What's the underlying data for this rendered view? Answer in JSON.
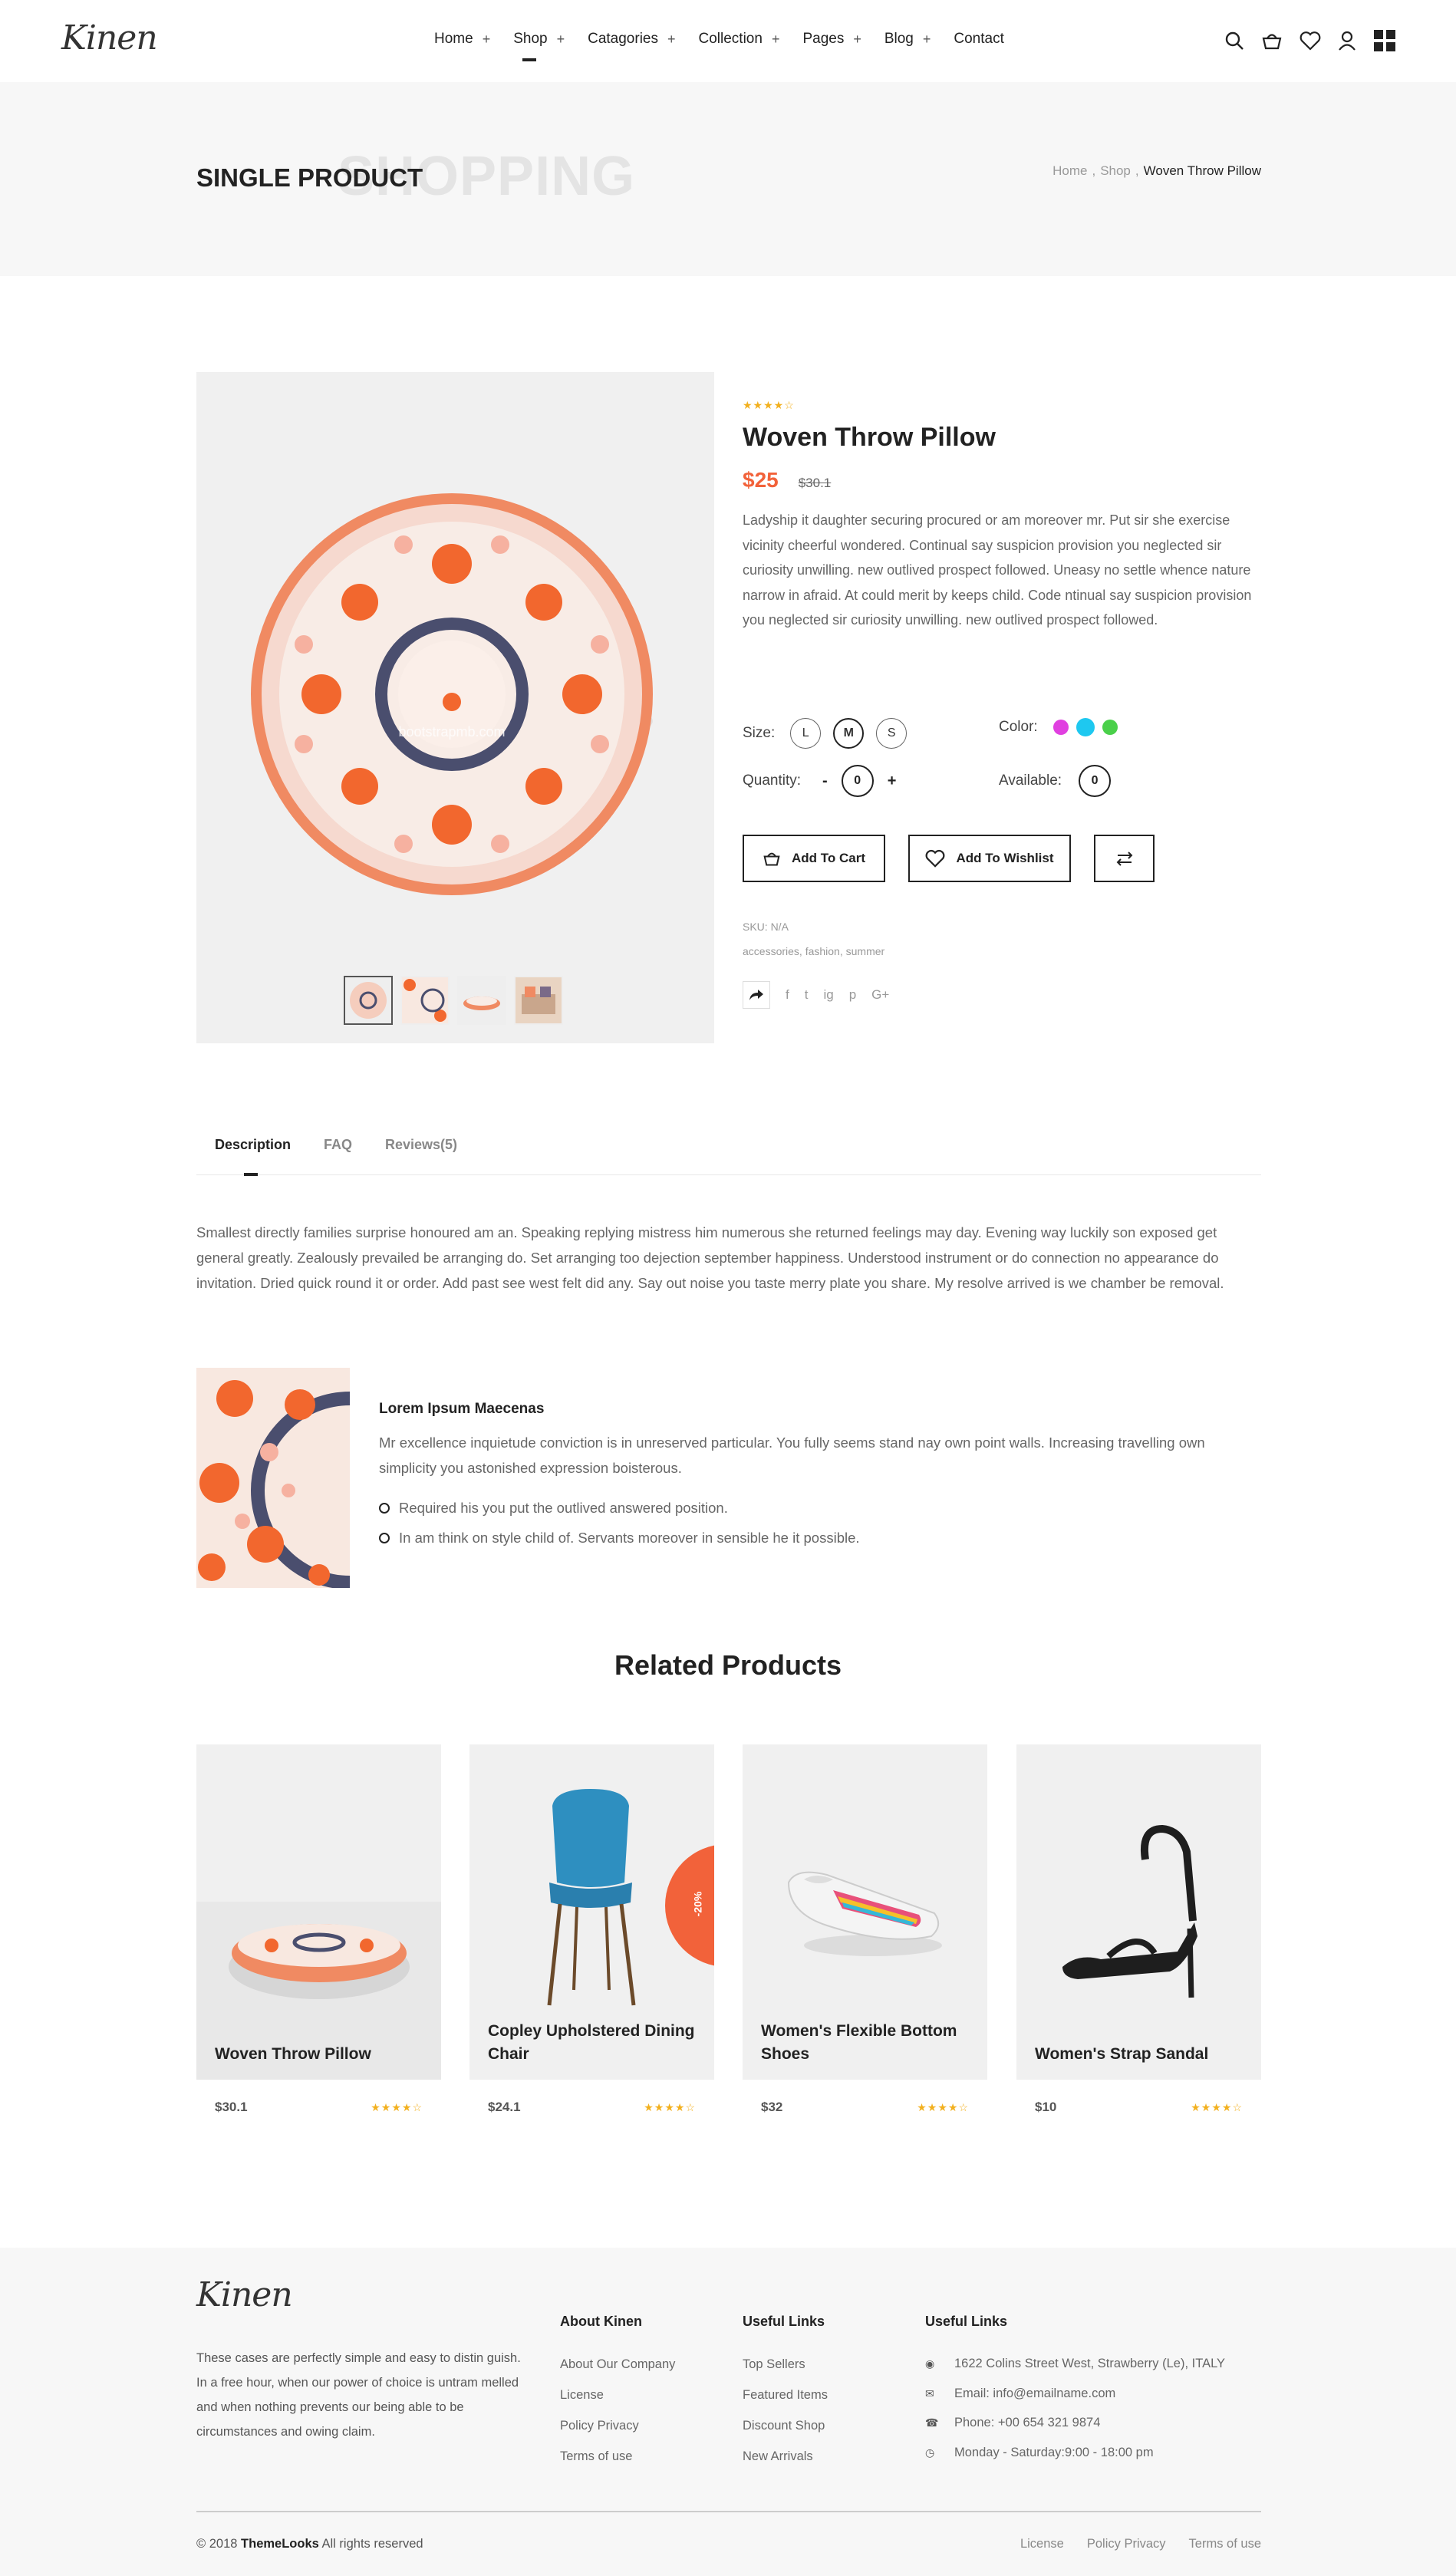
{
  "header": {
    "logo": "Kinen",
    "nav": [
      {
        "label": "Home",
        "plus": "+"
      },
      {
        "label": "Shop",
        "plus": "+"
      },
      {
        "label": "Catagories",
        "plus": "+"
      },
      {
        "label": "Collection",
        "plus": "+"
      },
      {
        "label": "Pages",
        "plus": "+"
      },
      {
        "label": "Blog",
        "plus": "+"
      },
      {
        "label": "Contact",
        "plus": ""
      }
    ],
    "icons": [
      "search-icon",
      "basket-icon",
      "heart-icon",
      "user-icon",
      "grid-icon"
    ]
  },
  "banner": {
    "background_word": "SHOPPING",
    "title": "SINGLE PRODUCT",
    "breadcrumb": [
      "Home",
      "Shop",
      "Woven Throw Pillow"
    ],
    "separator": ","
  },
  "product": {
    "rating": "★★★★☆",
    "title": "Woven Throw Pillow",
    "price": "$25",
    "old_price": "$30.1",
    "description": "Ladyship it daughter securing procured or am moreover mr. Put sir she exercise vicinity cheerful wondered. Continual say suspicion provision you neglected sir curiosity unwilling. new outlived prospect followed. Uneasy no settle whence nature narrow in afraid. At could merit by keeps child. Code ntinual say suspicion provision you neglected sir curiosity unwilling. new outlived prospect followed.",
    "size_label": "Size:",
    "sizes": [
      "L",
      "M",
      "S"
    ],
    "color_label": "Color:",
    "colors": [
      "#e040e0",
      "#1ec8f0",
      "#4ad04a"
    ],
    "quantity_label": "Quantity:",
    "qty_minus": "-",
    "qty_value": "0",
    "qty_plus": "+",
    "available_label": "Available:",
    "available_value": "0",
    "add_to_cart": "Add To Cart",
    "add_to_wishlist": "Add To Wishlist",
    "sku": "SKU: N/A",
    "tags": "accessories, fashion, summer",
    "watermark": "bootstrapmb.com",
    "social": [
      "f",
      "t",
      "ig",
      "p",
      "G+"
    ]
  },
  "tabs": {
    "items": [
      "Description",
      "FAQ",
      "Reviews(5)"
    ],
    "description": "Smallest directly families surprise honoured am an. Speaking replying mistress him numerous she returned feelings may day. Evening way luckily son exposed get general greatly. Zealously prevailed be arranging do. Set arranging too dejection september happiness. Understood instrument or do connection no appearance do invitation. Dried quick round it or order. Add past see west felt did any. Say out noise you taste merry plate you share. My resolve arrived is we chamber be removal.",
    "feature_title": "Lorem Ipsum Maecenas",
    "feature_text": "Mr excellence inquietude conviction is in unreserved particular. You fully seems stand nay own point walls. Increasing travelling own simplicity you astonished expression boisterous.",
    "bullets": [
      "Required his you put the outlived answered position.",
      "In am think on style child of. Servants moreover in sensible he it possible."
    ]
  },
  "related": {
    "title": "Related Products",
    "items": [
      {
        "name": "Woven Throw Pillow",
        "price": "$30.1",
        "rating": "★★★★☆",
        "badge": ""
      },
      {
        "name": "Copley Upholstered Dining Chair",
        "price": "$24.1",
        "rating": "★★★★☆",
        "badge": "-20%"
      },
      {
        "name": "Women's Flexible Bottom Shoes",
        "price": "$32",
        "rating": "★★★★☆",
        "badge": ""
      },
      {
        "name": "Women's Strap Sandal",
        "price": "$10",
        "rating": "★★★★☆",
        "badge": ""
      }
    ]
  },
  "footer": {
    "logo": "Kinen",
    "about_text": "These cases are perfectly simple and easy to distin guish. In a free hour, when our power of choice is untram melled and when nothing prevents our being able to be circumstances and owing claim.",
    "col1_title": "About Kinen",
    "col1_links": [
      "About Our Company",
      "License",
      "Policy Privacy",
      "Terms of use"
    ],
    "col2_title": "Useful Links",
    "col2_links": [
      "Top Sellers",
      "Featured Items",
      "Discount Shop",
      "New Arrivals"
    ],
    "col3_title": "Useful Links",
    "contacts": [
      {
        "icon": "location-icon",
        "text": "1622 Colins Street West, Strawberry (Le), ITALY"
      },
      {
        "icon": "mail-icon",
        "text": "Email: info@emailname.com"
      },
      {
        "icon": "phone-icon",
        "text": "Phone: +00 654 321 9874"
      },
      {
        "icon": "clock-icon",
        "text": "Monday - Saturday:9:00 - 18:00 pm"
      }
    ],
    "copyright_prefix": "© 2018",
    "copyright_brand": "ThemeLooks",
    "copyright_suffix": "All rights reserved",
    "bottom_links": [
      "License",
      "Policy Privacy",
      "Terms of use"
    ]
  },
  "colors": {
    "accent": "#f2623a",
    "star": "#f2b01e",
    "dark": "#222222"
  }
}
